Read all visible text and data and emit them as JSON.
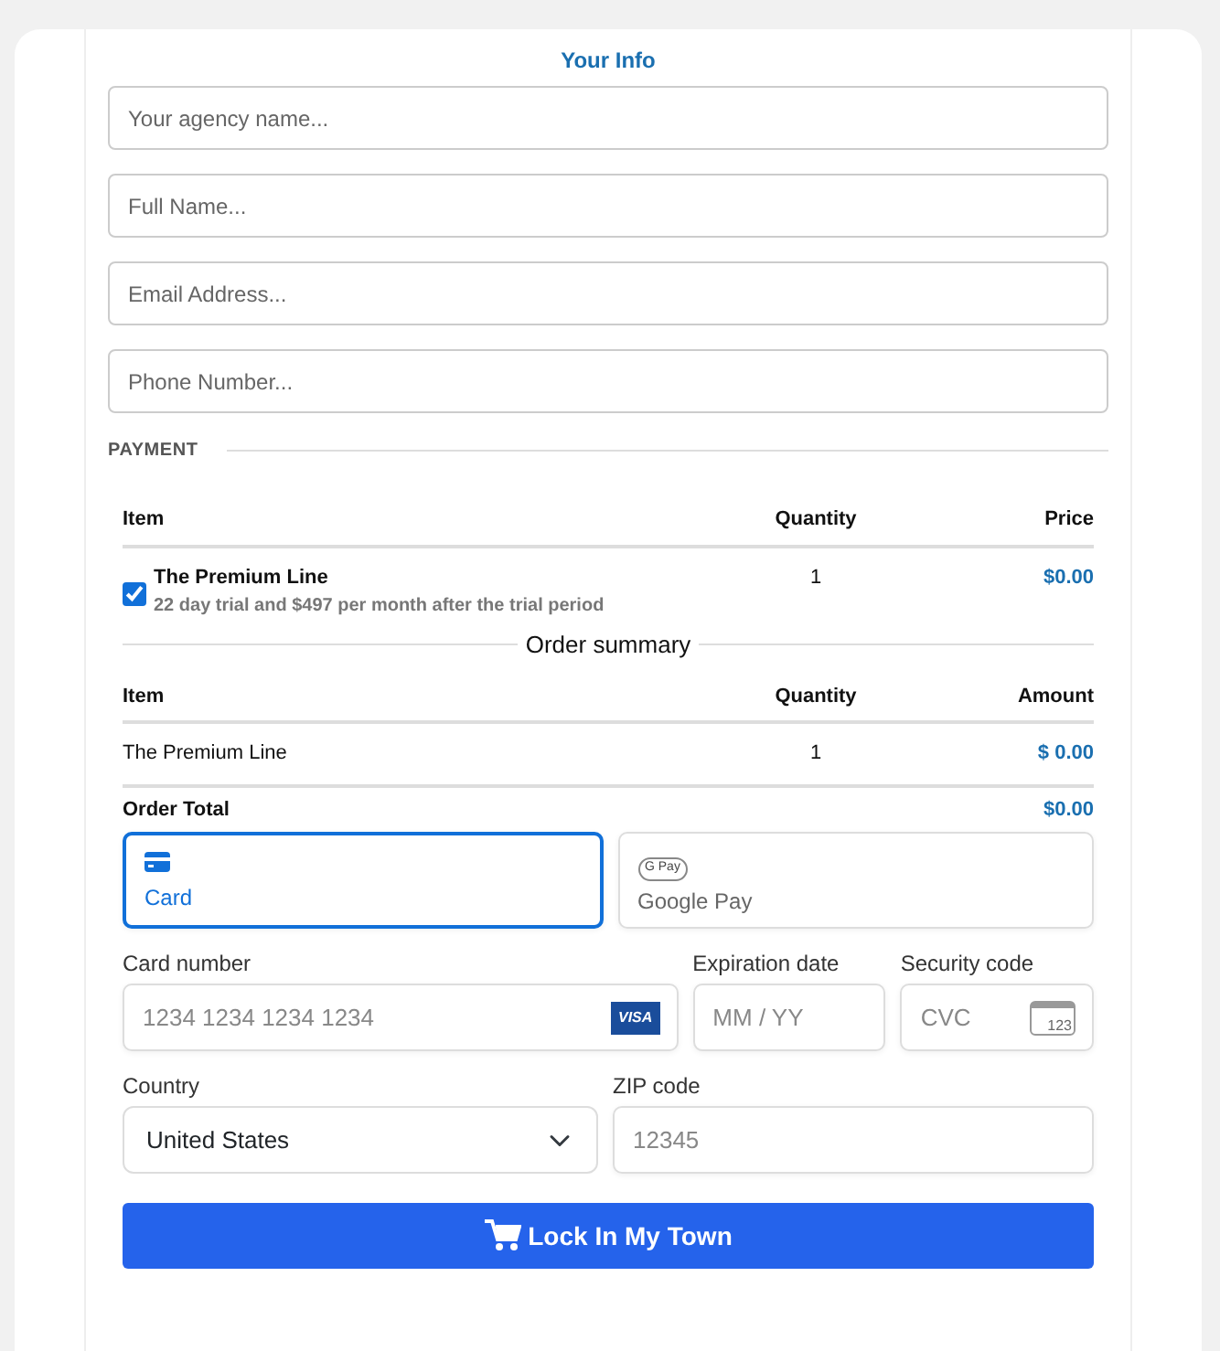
{
  "section_title": "Your Info",
  "fields": [
    {
      "placeholder": "Your agency name..."
    },
    {
      "placeholder": "Full Name..."
    },
    {
      "placeholder": "Email Address..."
    },
    {
      "placeholder": "Phone Number..."
    }
  ],
  "payment_heading": "PAYMENT",
  "products": {
    "columns": [
      "Item",
      "Quantity",
      "Price"
    ],
    "rows": [
      {
        "name": "The Premium Line",
        "description": "22 day trial and $497 per month after the trial period",
        "checked": true,
        "quantity": "1",
        "price": "$0.00"
      }
    ]
  },
  "summary_title": "Order summary",
  "summary": {
    "columns": [
      "Item",
      "Quantity",
      "Amount"
    ],
    "rows": [
      {
        "name": "The Premium Line",
        "quantity": "1",
        "amount": "$ 0.00"
      }
    ],
    "total_label": "Order Total",
    "total": "$0.00"
  },
  "payment_methods": [
    {
      "kind": "card",
      "label": "Card",
      "selected": true
    },
    {
      "kind": "gpay",
      "label": "Google Pay",
      "badge": "G Pay",
      "selected": false
    }
  ],
  "card_number": {
    "label": "Card number",
    "placeholder": "1234 1234 1234 1234",
    "brand": "VISA"
  },
  "expiration": {
    "label": "Expiration date",
    "placeholder": "MM / YY"
  },
  "security": {
    "label": "Security code",
    "placeholder": "CVC",
    "icon_text": "123"
  },
  "country": {
    "label": "Country",
    "value": "United States"
  },
  "zip": {
    "label": "ZIP code",
    "placeholder": "12345"
  },
  "submit": "Lock In My Town"
}
